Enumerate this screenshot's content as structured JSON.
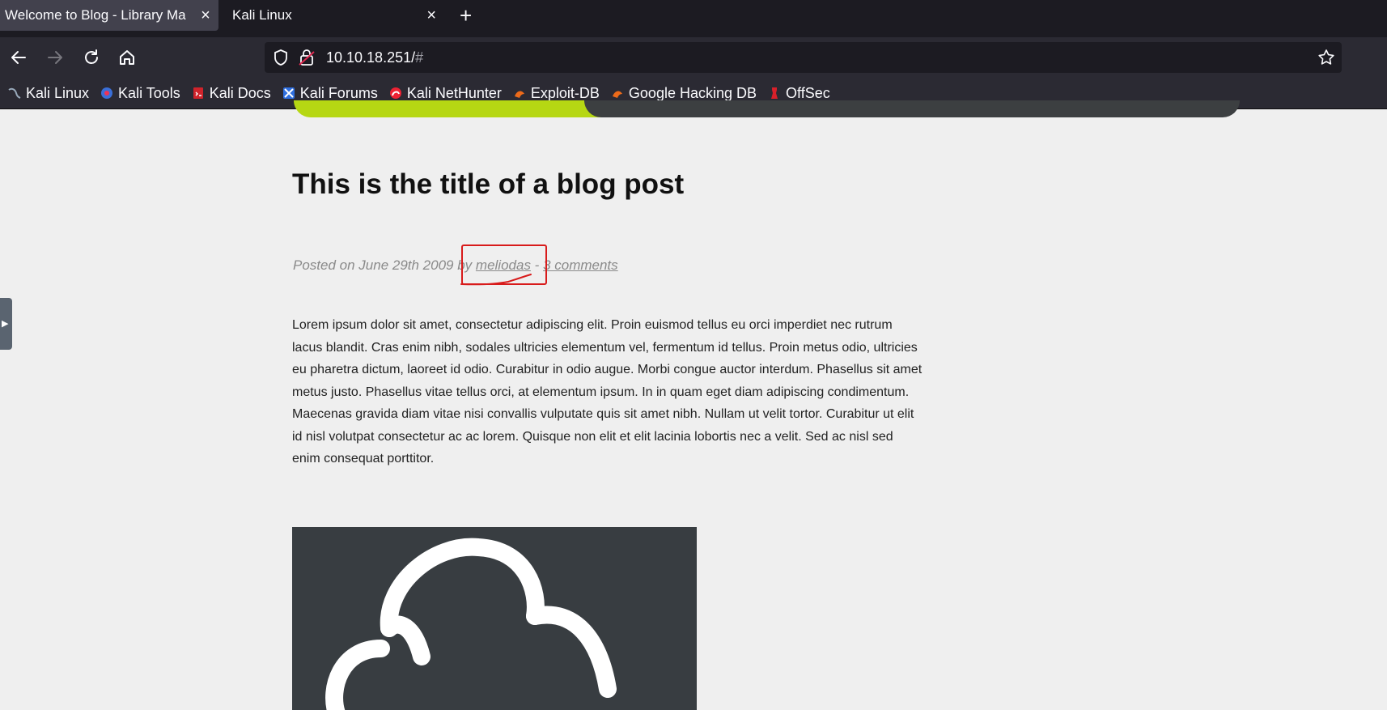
{
  "browser": {
    "tabs": [
      {
        "title": "Welcome to Blog - Library Ma",
        "active": true
      },
      {
        "title": "Kali Linux",
        "active": false
      }
    ],
    "new_tab": "+",
    "close_glyph": "×",
    "url": {
      "host": "10.10.18.251/",
      "hash": "#"
    },
    "bookmarks": [
      {
        "label": "Kali Linux",
        "icon": "kali-dragon-icon"
      },
      {
        "label": "Kali Tools",
        "icon": "kali-tools-icon"
      },
      {
        "label": "Kali Docs",
        "icon": "kali-docs-icon"
      },
      {
        "label": "Kali Forums",
        "icon": "kali-forums-icon"
      },
      {
        "label": "Kali NetHunter",
        "icon": "nethunter-icon"
      },
      {
        "label": "Exploit-DB",
        "icon": "exploit-db-icon"
      },
      {
        "label": "Google Hacking DB",
        "icon": "ghdb-icon"
      },
      {
        "label": "OffSec",
        "icon": "offsec-icon"
      }
    ]
  },
  "post": {
    "title": "This is the title of a blog post",
    "meta_prefix": "Posted on June 29th 2009 by ",
    "author": "meliodas",
    "separator": " - ",
    "comments": "3 comments",
    "body": "Lorem ipsum dolor sit amet, consectetur adipiscing elit. Proin euismod tellus eu orci imperdiet nec rutrum lacus blandit. Cras enim nibh, sodales ultricies elementum vel, fermentum id tellus. Proin metus odio, ultricies eu pharetra dictum, laoreet id odio. Curabitur in odio augue. Morbi congue auctor interdum. Phasellus sit amet metus justo. Phasellus vitae tellus orci, at elementum ipsum. In in quam eget diam adipiscing condimentum. Maecenas gravida diam vitae nisi convallis vulputate quis sit amet nibh. Nullam ut velit tortor. Curabitur ut elit id nisl volutpat consectetur ac ac lorem. Quisque non elit et elit lacinia lobortis nec a velit. Sed ac nisl sed enim consequat porttitor."
  },
  "colors": {
    "accent_green": "#b6d713",
    "annotation_red": "#d81b1b",
    "banner_dark": "#3c3f41"
  }
}
